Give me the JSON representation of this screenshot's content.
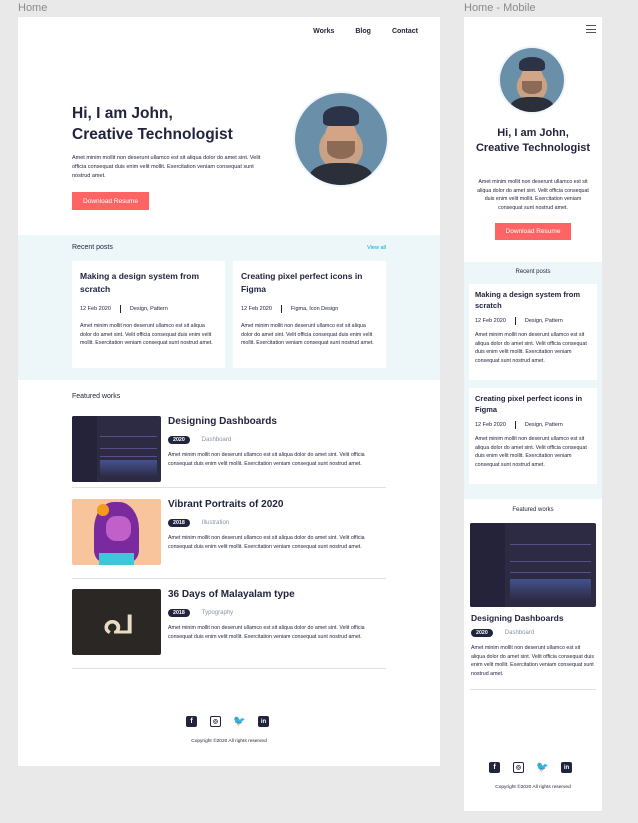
{
  "frames": {
    "desktop_label": "Home",
    "mobile_label": "Home - Mobile"
  },
  "nav": {
    "works": "Works",
    "blog": "Blog",
    "contact": "Contact"
  },
  "hero": {
    "title_line1": "Hi, I am John,",
    "title_line2": "Creative Technologist",
    "intro": "Amet minim mollit non deserunt ullamco est sit aliqua dolor do amet sint. Velit officia consequat duis enim velit mollit. Exercitation veniam consequat sunt nostrud amet.",
    "button": "Download Resume"
  },
  "recent": {
    "title": "Recent posts",
    "view_all": "View all",
    "posts": [
      {
        "title": "Making a design system from scratch",
        "date": "12 Feb 2020",
        "tags": "Design, Pattern",
        "excerpt": "Amet minim mollit non deserunt ullamco est sit aliqua dolor do amet sint. Velit officia consequat duis enim velit mollit. Exercitation veniam consequat sunt nostrud amet."
      },
      {
        "title": "Creating pixel perfect icons in Figma",
        "date": "12 Feb 2020",
        "tags_desktop": "Figma, Icon Design",
        "tags_mobile": "Design, Pattern",
        "excerpt": "Amet minim mollit non deserunt ullamco est sit aliqua dolor do amet sint. Velit officia consequat duis enim velit mollit. Exercitation veniam consequat sunt nostrud amet."
      }
    ]
  },
  "featured": {
    "title": "Featured works",
    "works": [
      {
        "title": "Designing Dashboards",
        "year": "2020",
        "category": "Dashboard",
        "description": "Amet minim mollit non deserunt ullamco est sit aliqua dolor do amet sint. Velit officia consequat duis enim velit mollit. Exercitation veniam consequat sunt nostrud amet."
      },
      {
        "title": "Vibrant Portraits of 2020",
        "year": "2018",
        "category": "Illustration",
        "description": "Amet minim mollit non deserunt ullamco est sit aliqua dolor do amet sint. Velit officia consequat duis enim velit mollit. Exercitation veniam consequat sunt nostrud amet."
      },
      {
        "title": "36 Days of Malayalam type",
        "year": "2018",
        "category": "Typography",
        "thumb_glyph": "പ",
        "description": "Amet minim mollit non deserunt ullamco est sit aliqua dolor do amet sint. Velit officia consequat duis enim velit mollit. Exercitation veniam consequat sunt nostrud amet."
      }
    ]
  },
  "footer": {
    "icons": [
      "facebook-icon",
      "instagram-icon",
      "twitter-icon",
      "linkedin-icon"
    ],
    "copyright": "Copyright ©2020 All rights reserved"
  },
  "colors": {
    "accent": "#ff6464",
    "dark": "#21243d",
    "tint": "#edf7fa",
    "link": "#00a8cc",
    "muted": "#8695a4"
  }
}
